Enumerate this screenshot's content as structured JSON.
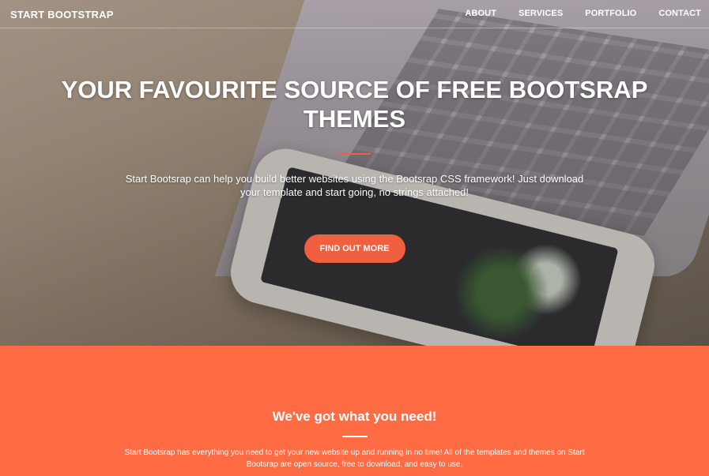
{
  "navbar": {
    "brand": "START BOOTSTRAP",
    "links": [
      "ABOUT",
      "SERVICES",
      "PORTFOLIO",
      "CONTACT"
    ]
  },
  "hero": {
    "title": "YOUR FAVOURITE SOURCE OF FREE BOOTSRAP THEMES",
    "subtitle": "Start Bootsrap can help you build better websites using the Bootsrap CSS framework! Just download your template and start going, no strings attached!",
    "cta_label": "FIND OUT MORE"
  },
  "services": {
    "title": "We've got what you need!",
    "text": "Start Bootsrap has everything you need to get your new website up and running in no time! All of the templates and themes on Start Bootsrap are open source, free to download, and easy to use."
  },
  "colors": {
    "accent": "#f05f40",
    "section_bg": "#ff6b42"
  }
}
